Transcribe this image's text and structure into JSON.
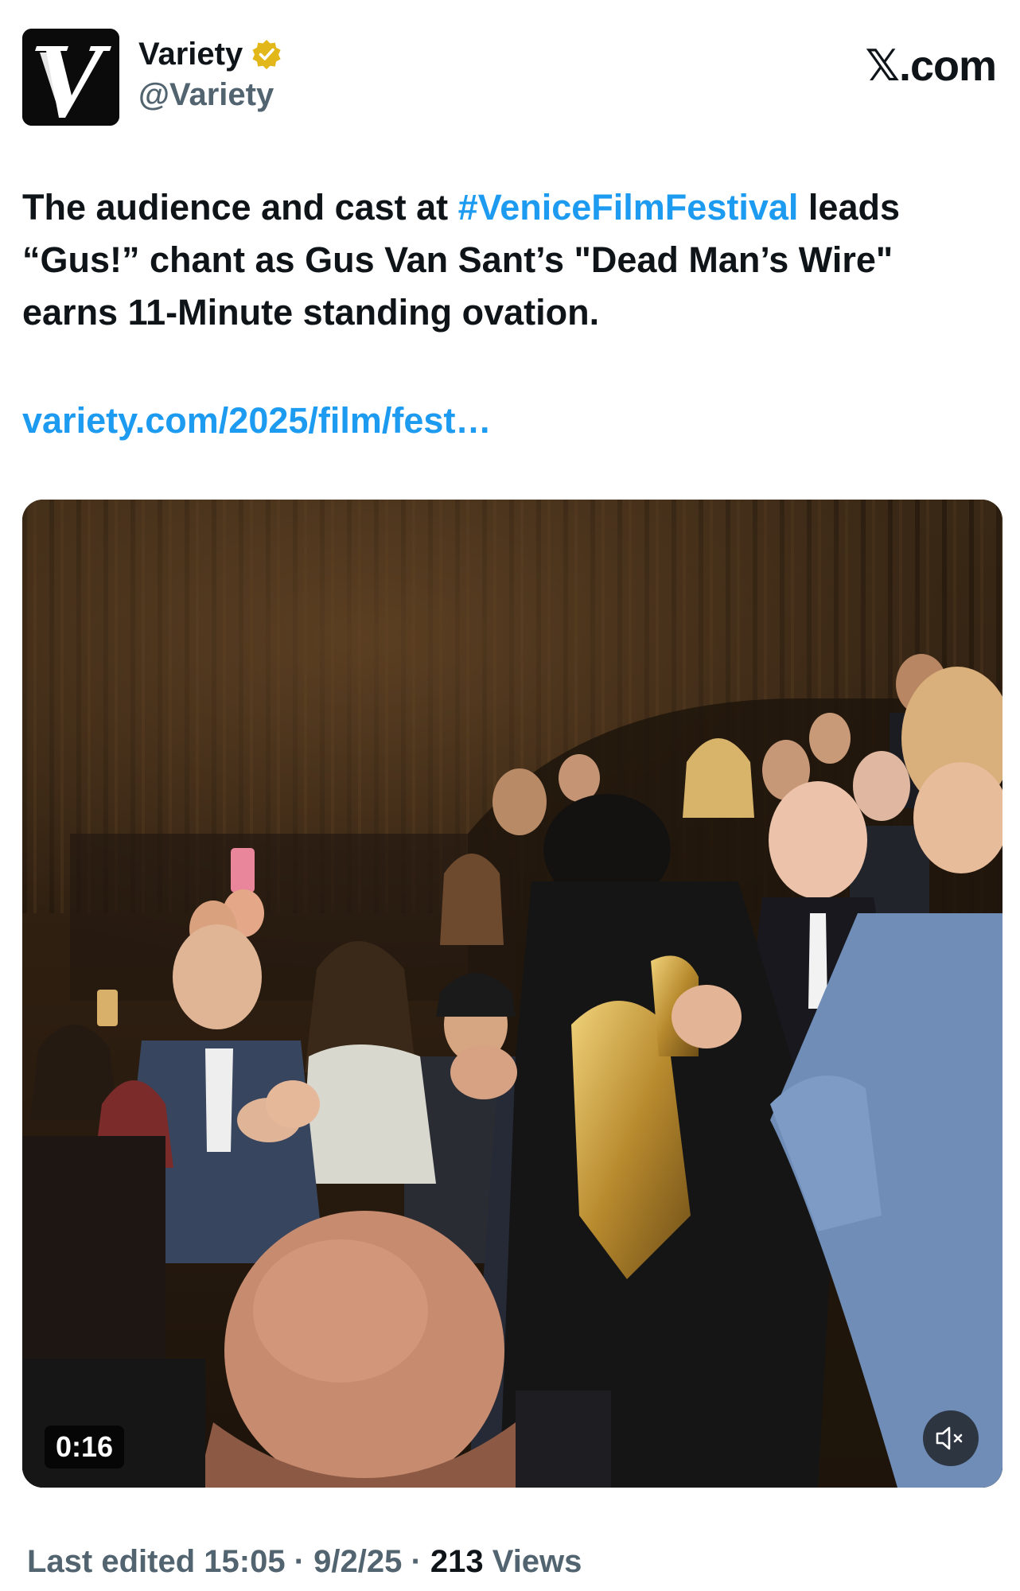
{
  "account": {
    "display_name": "Variety",
    "handle": "@Variety",
    "logo_icon": "variety-v-logo",
    "verified_icon": "gold-verified-badge-icon"
  },
  "source": {
    "site": "X.com",
    "mark": "𝕏",
    "rest": ".com"
  },
  "tweet": {
    "text_before": "The audience and cast at ",
    "hashtag": "#VeniceFilmFestival",
    "text_after": " leads “Gus!” chant as Gus Van Sant’s \"Dead Man’s Wire\" earns 11-Minute standing ovation.",
    "link": "variety.com/2025/film/fest…"
  },
  "video": {
    "duration": "0:16",
    "mute_icon": "speaker-muted-icon",
    "description_icon": "video-thumbnail"
  },
  "footer": {
    "edited": "Last edited 15:05 · 9/2/25",
    "separator": " · ",
    "views_count": "213",
    "views_label": " Views"
  },
  "colors": {
    "link": "#1d9bf0",
    "text": "#0f1419",
    "secondary": "#536471",
    "verified": "#e2b719"
  }
}
